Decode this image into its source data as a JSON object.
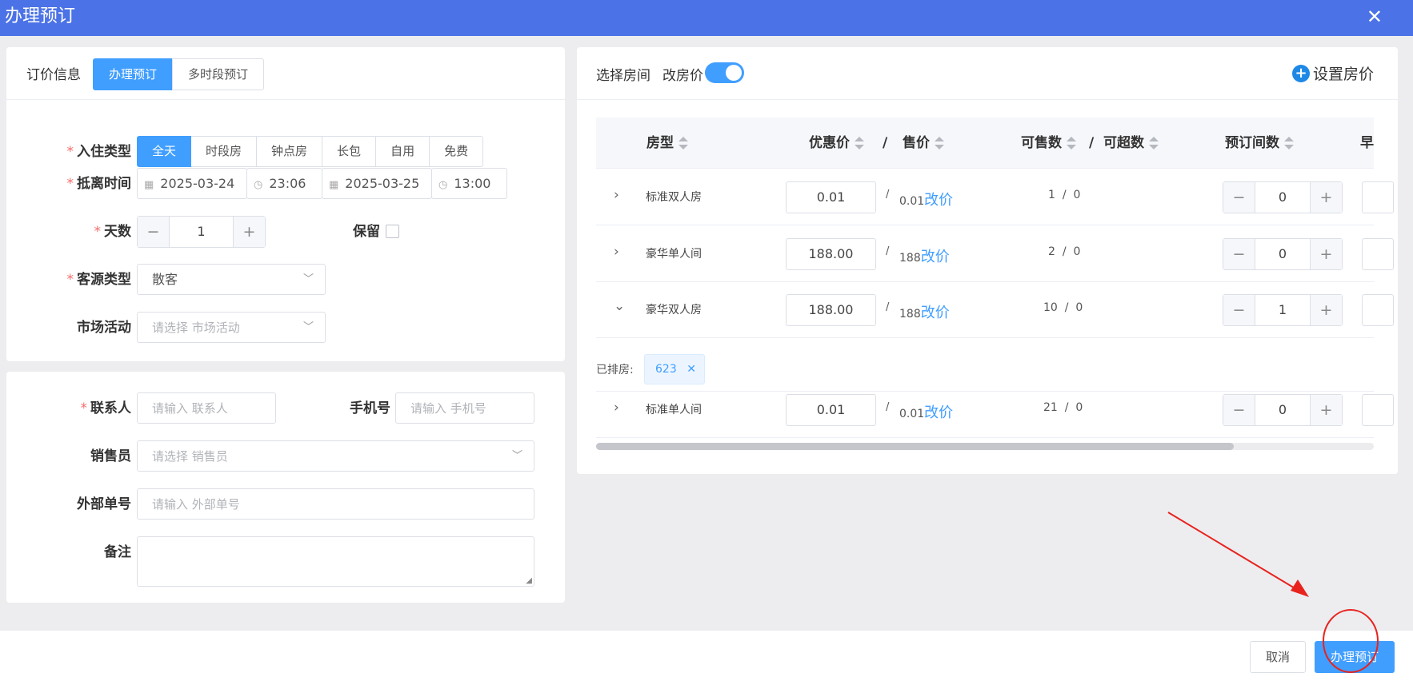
{
  "window": {
    "title": "办理预订",
    "close_glyph": "✕"
  },
  "pricing": {
    "label": "订价信息",
    "tabs": [
      "办理预订",
      "多时段预订"
    ],
    "fields": {
      "checkin_type_label": "入住类型",
      "checkin_types": [
        "全天",
        "时段房",
        "钟点房",
        "长包",
        "自用",
        "免费"
      ],
      "arrive_depart_label": "抵离时间",
      "arrive_date": "2025-03-24",
      "arrive_time": "23:06",
      "depart_date": "2025-03-25",
      "depart_time": "13:00",
      "days_label": "天数",
      "days_value": "1",
      "reserve_label": "保留",
      "source_label": "客源类型",
      "source_value": "散客",
      "campaign_label": "市场活动",
      "campaign_placeholder": "请选择 市场活动"
    }
  },
  "contact": {
    "contact_label": "联系人",
    "contact_placeholder": "请输入 联系人",
    "phone_label": "手机号",
    "phone_placeholder": "请输入 手机号",
    "sales_label": "销售员",
    "sales_placeholder": "请选择 销售员",
    "external_label": "外部单号",
    "external_placeholder": "请输入 外部单号",
    "remark_label": "备注"
  },
  "rooms": {
    "select_label": "选择房间",
    "change_price_label": "改房价",
    "change_price_on": true,
    "set_price_label": "设置房价",
    "columns": {
      "type": "房型",
      "discount": "优惠价",
      "slash": "/",
      "sale": "售价",
      "available": "可售数",
      "over": "可超数",
      "booked": "预订间数",
      "breakfast": "早"
    },
    "change_link": "改价",
    "rows": [
      {
        "name": "标准双人房",
        "discount": "0.01",
        "sale": "0.01",
        "available": "1",
        "over": "0",
        "booked": "0",
        "expanded": false
      },
      {
        "name": "豪华单人间",
        "discount": "188.00",
        "sale": "188",
        "available": "2",
        "over": "0",
        "booked": "0",
        "expanded": false
      },
      {
        "name": "豪华双人房",
        "discount": "188.00",
        "sale": "188",
        "available": "10",
        "over": "0",
        "booked": "1",
        "expanded": true
      },
      {
        "name": "标准单人间",
        "discount": "0.01",
        "sale": "0.01",
        "available": "21",
        "over": "0",
        "booked": "0",
        "expanded": false
      }
    ],
    "arranged_label": "已排房:",
    "arranged_rooms": [
      "623"
    ],
    "scroll_fraction": 0.82
  },
  "footer": {
    "cancel_label": "取消",
    "submit_label": "办理预订"
  },
  "colors": {
    "header": "#4b72e6",
    "primary": "#409eff",
    "required": "#f56c6c",
    "annotation": "#e8231e"
  }
}
